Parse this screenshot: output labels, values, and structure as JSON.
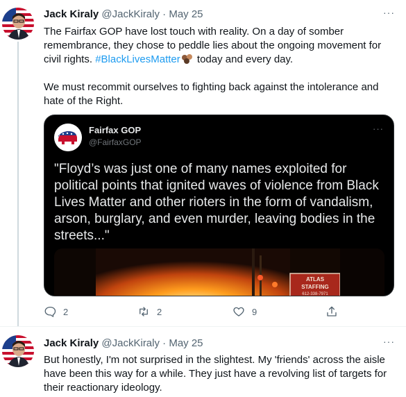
{
  "tweet1": {
    "name": "Jack Kiraly",
    "handle": "@JackKiraly",
    "separator": "·",
    "date": "May 25",
    "more": "···",
    "text_line_a": "The Fairfax GOP have lost touch with reality. On a day of somber remembrance, they chose to peddle lies about the ongoing movement for civil rights. ",
    "hashtag": "#BlackLivesMatter",
    "emoji": "raised-fist-emoji",
    "text_line_b": " today and every day.",
    "paragraph2": "We must recommit ourselves to fighting back against the intolerance and hate of the Right.",
    "quote": {
      "name": "Fairfax GOP",
      "handle": "@FairfaxGOP",
      "more": "···",
      "text": "\"Floyd’s was just one of many names exploited for political points that ignited waves of violence from Black Lives Matter and other rioters in the form of vandalism, arson, burglary, and even murder, leaving bodies in the streets...\"",
      "media_sign_line1": "ATLAS",
      "media_sign_line2": "STAFFING",
      "media_sign_line3": "612-338-7971"
    },
    "actions": {
      "reply_count": "2",
      "retweet_count": "2",
      "like_count": "9",
      "share_icon": "share-icon"
    }
  },
  "tweet2": {
    "name": "Jack Kiraly",
    "handle": "@JackKiraly",
    "separator": "·",
    "date": "May 25",
    "more": "···",
    "text": "But honestly, I'm not surprised in the slightest. My 'friends' across the aisle have been this way for a while. They just have a revolving list of targets for their reactionary ideology."
  },
  "colors": {
    "link": "#1d9bf0",
    "muted": "#536471",
    "quote_bg": "#000000",
    "thread_line": "#cfd9de"
  }
}
